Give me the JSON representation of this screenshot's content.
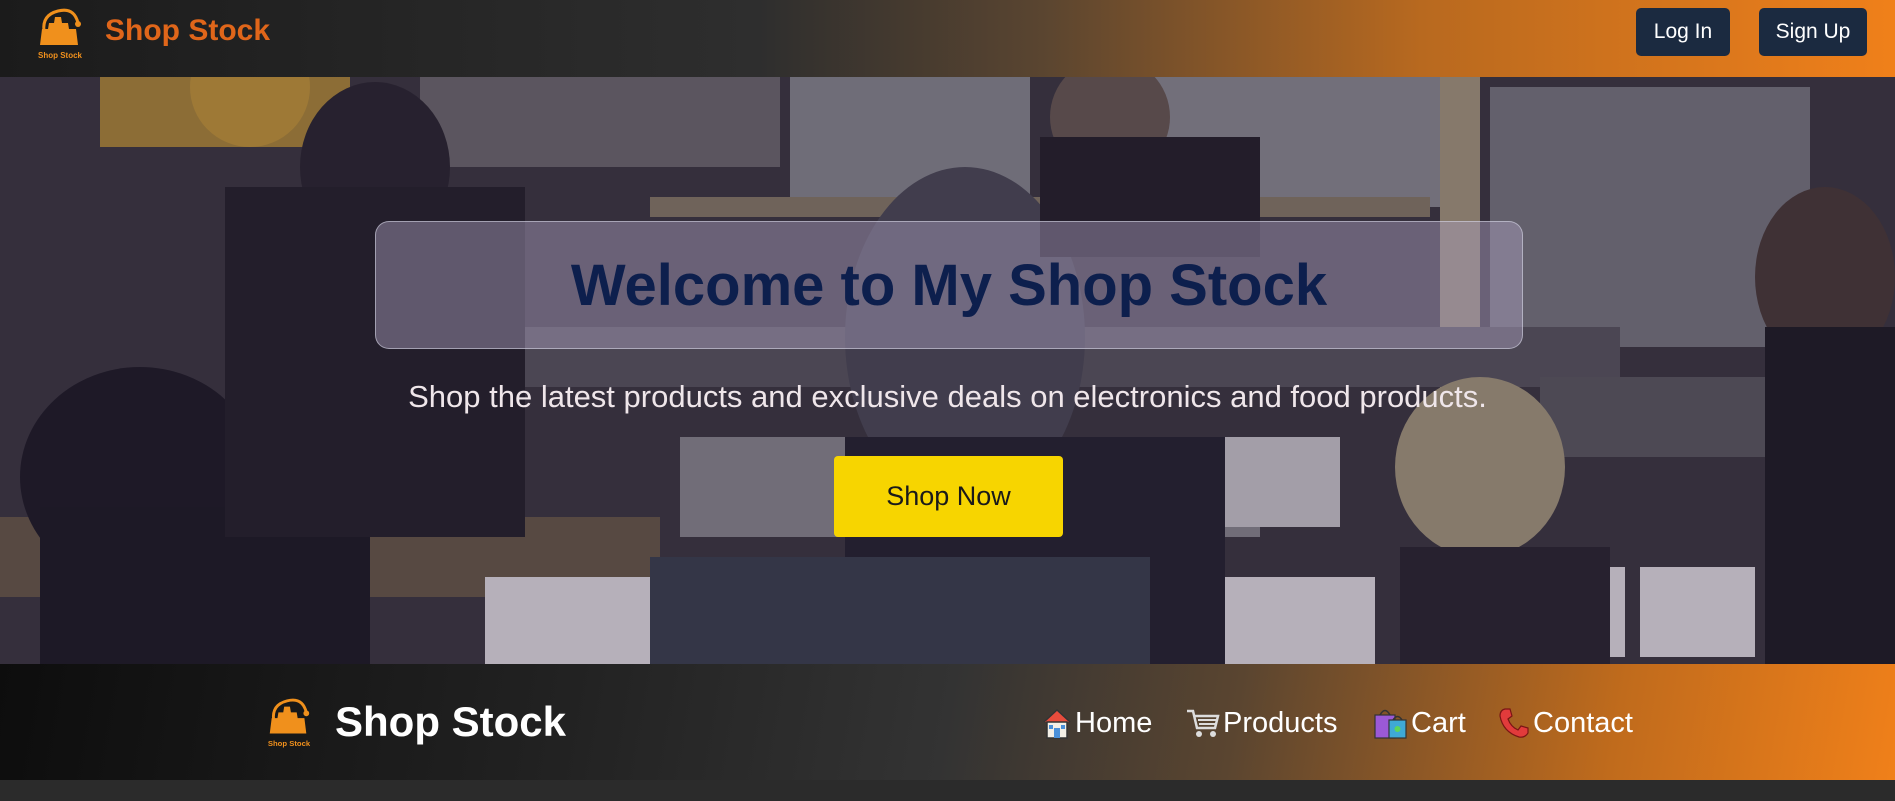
{
  "header": {
    "brand": "Shop Stock",
    "logo_caption": "Shop Stock",
    "login_label": "Log In",
    "signup_label": "Sign Up"
  },
  "hero": {
    "title": "Welcome to My Shop Stock",
    "subtitle": "Shop the latest products and exclusive deals on electronics and food products.",
    "cta_label": "Shop Now"
  },
  "nav": {
    "brand": "Shop Stock",
    "logo_caption": "Shop Stock",
    "items": [
      {
        "label": "Home",
        "icon": "house-icon"
      },
      {
        "label": "Products",
        "icon": "cart-icon"
      },
      {
        "label": "Cart",
        "icon": "shopping-bags-icon"
      },
      {
        "label": "Contact",
        "icon": "telephone-icon"
      }
    ]
  },
  "colors": {
    "brand_orange": "#e0661a",
    "button_navy": "#1b2a40",
    "cta_yellow": "#f7d500",
    "title_navy": "#0d1f4d"
  }
}
